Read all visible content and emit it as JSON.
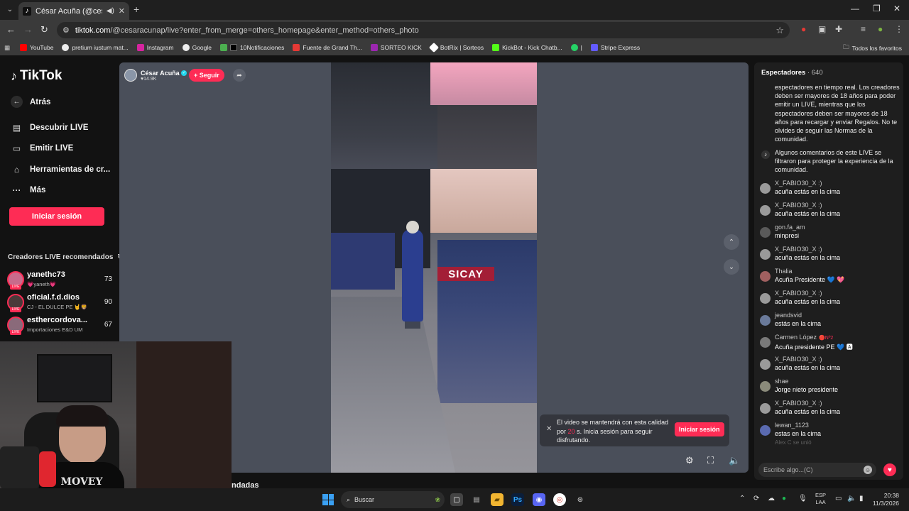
{
  "browser": {
    "tab_title": "César Acuña (@cesaracuna",
    "url_host": "tiktok.com",
    "url_path": "/@cesaracunap/live?enter_from_merge=others_homepage&enter_method=others_photo",
    "bookmarks": [
      "YouTube",
      "pretium iustum mat...",
      "Instagram",
      "Google",
      "10Notificaciones",
      "Fuente de Grand Th...",
      "SORTEO KICK",
      "BotRix | Sorteos",
      "KickBot - Kick Chatb...",
      "|",
      "Stripe Express"
    ],
    "bookmarks_folder": "Todos los favoritos"
  },
  "sidebar": {
    "brand": "TikTok",
    "back_label": "Atrás",
    "items": [
      {
        "label": "Descubrir LIVE"
      },
      {
        "label": "Emitir LIVE"
      },
      {
        "label": "Herramientas de cr..."
      },
      {
        "label": "Más"
      }
    ],
    "login_label": "Iniciar sesión",
    "creators_title": "Creadores LIVE recomendados",
    "creators": [
      {
        "name": "yanethc73",
        "sub": "💗yaneth💗",
        "count": "73"
      },
      {
        "name": "oficial.f.d.dios",
        "sub": "CJ - EL DULCE PE 🤘🦁",
        "count": "90"
      },
      {
        "name": "esthercordova...",
        "sub": "Importaciones E&D UM",
        "count": "67"
      }
    ]
  },
  "stream": {
    "host_name": "César Acuña",
    "host_likes": "♥14.9K",
    "follow_label": "+ Seguir",
    "banner_text": "SICAY",
    "toast_text_1": "El video se mantendrá con esta calidad por",
    "toast_seconds": "20",
    "toast_text_2": "s. Inicia sesión para seguir disfrutando.",
    "toast_button": "Iniciar sesión",
    "below_title": "ndadas"
  },
  "chat": {
    "header_label": "Espectadores",
    "viewer_count": "· 640",
    "system_message": "espectadores en tiempo real. Los creadores deben ser mayores de 18 años para poder emitir un LIVE, mientras que los espectadores deben ser mayores de 18 años para recargar y enviar Regalos. No te olvides de seguir las Normas de la comunidad.",
    "filter_notice": "Algunos comentarios de este LIVE se filtraron para proteger la experiencia de la comunidad.",
    "messages": [
      {
        "user": "X_FABIO30_X :)",
        "text": "acuña estás en la cima"
      },
      {
        "user": "X_FABIO30_X :)",
        "text": "acuña estás en la cima"
      },
      {
        "user": "gon.fa_am",
        "text": "minpresi"
      },
      {
        "user": "X_FABIO30_X :)",
        "text": "acuña estás en la cima"
      },
      {
        "user": "Thalia",
        "text": "Acuña Presidente 💙 💖"
      },
      {
        "user": "X_FABIO30_X :)",
        "text": "acuña estás en la cima"
      },
      {
        "user": "jeandsvid",
        "text": "estás en la cima"
      },
      {
        "user": "Carmen López",
        "badge": "🔴Nº2",
        "text": "Acuña presidente PE 💙 🅰"
      },
      {
        "user": "X_FABIO30_X :)",
        "text": "acuña estás en la cima"
      },
      {
        "user": "shae",
        "text": "Jorge nieto presidente"
      },
      {
        "user": "X_FABIO30_X :)",
        "text": "acuña estás en la cima"
      },
      {
        "user": "lewan_1123",
        "text": "estas en la cima"
      }
    ],
    "join_notice": "Alex C  se unió",
    "input_placeholder": "Escribe algo...(C)"
  },
  "webcam": {
    "shirt_text": "MOVEY"
  },
  "taskbar": {
    "search_label": "Buscar",
    "lang": "ESP",
    "lang2": "LAA",
    "time": "20:38",
    "date": "11/3/2026"
  }
}
